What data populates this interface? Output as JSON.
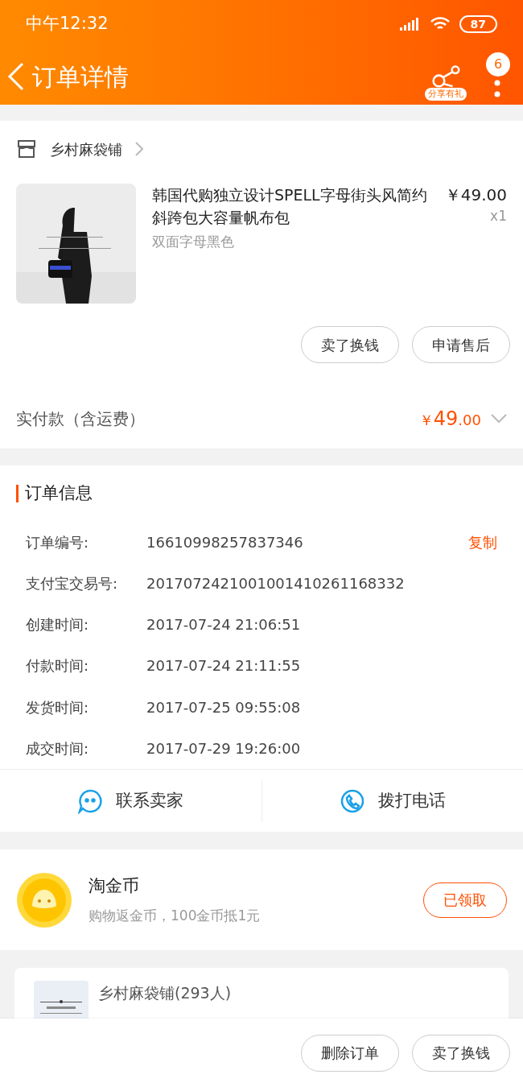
{
  "status_bar": {
    "time": "中午12:32",
    "battery": "87"
  },
  "header": {
    "title": "订单详情",
    "share_label": "分享有礼",
    "badge": "6"
  },
  "shop": {
    "name": "乡村麻袋铺"
  },
  "product": {
    "kind": "picture",
    "title": "韩国代购独立设计SPELL字母街头风简约斜跨包大容量帆布包",
    "price": "￥49.00",
    "quantity": "x1",
    "variant": "双面字母黑色"
  },
  "product_buttons": [
    "卖了换钱",
    "申请售后"
  ],
  "payment": {
    "label": "实付款（含运费）",
    "currency": "￥",
    "amount": "49",
    "decimals": ".00",
    "expanded": false
  },
  "order_info": {
    "title": "订单信息",
    "copy_label": "复制",
    "rows": [
      {
        "label": "订单编号:",
        "value": "16610998257837346"
      },
      {
        "label": "支付宝交易号:",
        "value": "2017072421001001410261168332"
      },
      {
        "label": "创建时间:",
        "value": "2017-07-24 21:06:51"
      },
      {
        "label": "付款时间:",
        "value": "2017-07-24 21:11:55"
      },
      {
        "label": "发货时间:",
        "value": "2017-07-25 09:55:08"
      },
      {
        "label": "成交时间:",
        "value": "2017-07-29 19:26:00"
      }
    ]
  },
  "contact": [
    {
      "kind": "chat",
      "label": "联系卖家"
    },
    {
      "kind": "phone",
      "label": "拨打电话"
    }
  ],
  "coins": {
    "title": "淘金币",
    "subtitle": "购物返金币，100金币抵1元",
    "button": "已领取",
    "claimed": true
  },
  "shop_card": {
    "name": "乡村麻袋铺(293人)"
  },
  "bottom_buttons": [
    "删除订单",
    "卖了换钱"
  ]
}
